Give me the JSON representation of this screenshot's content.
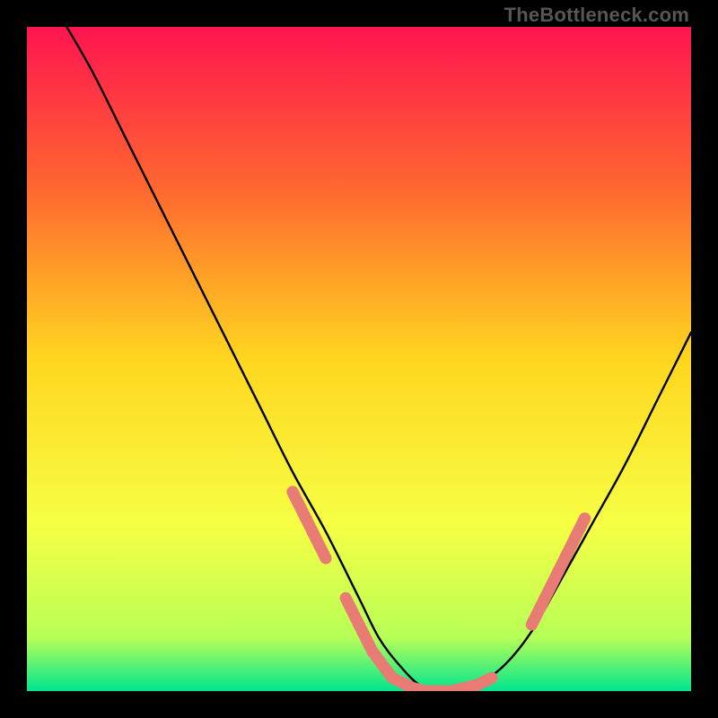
{
  "watermark": "TheBottleneck.com",
  "chart_data": {
    "type": "line",
    "title": "",
    "xlabel": "",
    "ylabel": "",
    "xlim": [
      0,
      100
    ],
    "ylim": [
      0,
      100
    ],
    "grid": false,
    "legend": false,
    "background_gradient": {
      "stops": [
        {
          "offset": 0.0,
          "color": "#ff1450"
        },
        {
          "offset": 0.25,
          "color": "#ff6a2f"
        },
        {
          "offset": 0.5,
          "color": "#ffd61f"
        },
        {
          "offset": 0.75,
          "color": "#f6ff44"
        },
        {
          "offset": 0.92,
          "color": "#b7ff57"
        },
        {
          "offset": 1.0,
          "color": "#00e58f"
        }
      ]
    },
    "series": [
      {
        "name": "curve",
        "color": "#000000",
        "x": [
          6,
          10,
          15,
          20,
          25,
          30,
          35,
          40,
          45,
          50,
          53,
          56,
          59,
          62,
          65,
          68,
          72,
          76,
          80,
          85,
          90,
          95,
          100
        ],
        "y": [
          100,
          93,
          83,
          73,
          63,
          53,
          43,
          33,
          24,
          14,
          8,
          4,
          1,
          0,
          0,
          1,
          4,
          9,
          16,
          25,
          34,
          44,
          54
        ]
      }
    ],
    "markers": {
      "name": "hot-points",
      "color": "#e87b74",
      "radius": 6,
      "points": [
        {
          "x": 40,
          "y": 30
        },
        {
          "x": 42,
          "y": 26
        },
        {
          "x": 43,
          "y": 24
        },
        {
          "x": 45,
          "y": 20
        },
        {
          "x": 48,
          "y": 14
        },
        {
          "x": 50,
          "y": 10
        },
        {
          "x": 52,
          "y": 6
        },
        {
          "x": 55,
          "y": 2
        },
        {
          "x": 58,
          "y": 0.5
        },
        {
          "x": 60,
          "y": 0
        },
        {
          "x": 62,
          "y": 0
        },
        {
          "x": 64,
          "y": 0
        },
        {
          "x": 66,
          "y": 0.5
        },
        {
          "x": 68,
          "y": 1
        },
        {
          "x": 70,
          "y": 2
        },
        {
          "x": 76,
          "y": 10
        },
        {
          "x": 78,
          "y": 14
        },
        {
          "x": 80,
          "y": 18
        },
        {
          "x": 81,
          "y": 20
        },
        {
          "x": 82,
          "y": 22
        },
        {
          "x": 84,
          "y": 26
        }
      ]
    }
  }
}
